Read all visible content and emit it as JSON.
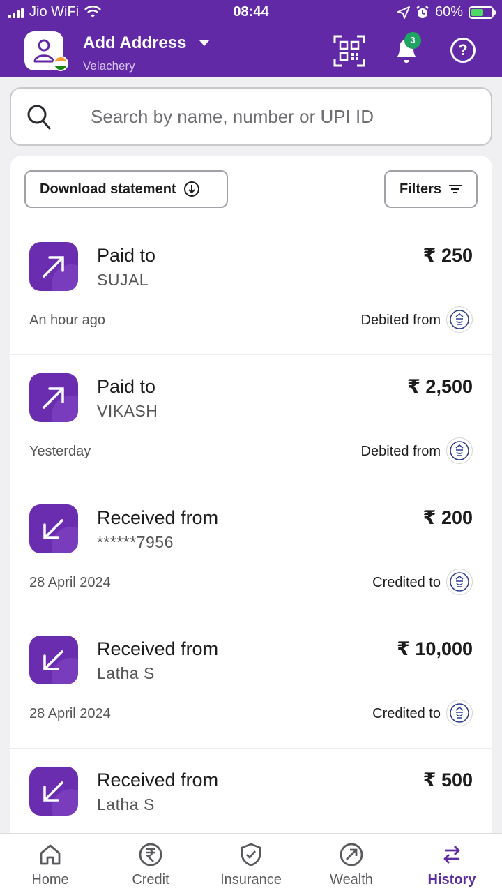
{
  "status_bar": {
    "carrier": "Jio WiFi",
    "time": "08:44",
    "battery": "60%"
  },
  "header": {
    "title": "Add Address",
    "location": "Velachery",
    "notification_count": "3",
    "help_label": "?"
  },
  "search": {
    "placeholder": "Search by name, number or UPI ID"
  },
  "actions": {
    "download_label": "Download statement",
    "filters_label": "Filters"
  },
  "transactions": [
    {
      "type": "Paid to",
      "party": "SUJAL",
      "amount": "₹ 250",
      "date": "An hour ago",
      "account": "Debited from",
      "direction": "outgoing"
    },
    {
      "type": "Paid to",
      "party": "VIKASH",
      "amount": "₹ 2,500",
      "date": "Yesterday",
      "account": "Debited from",
      "direction": "outgoing"
    },
    {
      "type": "Received from",
      "party": "******7956",
      "amount": "₹ 200",
      "date": "28 April 2024",
      "account": "Credited to",
      "direction": "incoming"
    },
    {
      "type": "Received from",
      "party": "Latha S",
      "amount": "₹ 10,000",
      "date": "28 April 2024",
      "account": "Credited to",
      "direction": "incoming"
    },
    {
      "type": "Received from",
      "party": "Latha S",
      "amount": "₹ 500",
      "date": "",
      "account": "",
      "direction": "incoming"
    }
  ],
  "bottom_nav": [
    {
      "label": "Home",
      "icon": "home-icon"
    },
    {
      "label": "Credit",
      "icon": "rupee-icon"
    },
    {
      "label": "Insurance",
      "icon": "shield-check-icon"
    },
    {
      "label": "Wealth",
      "icon": "compass-arrow-icon"
    },
    {
      "label": "History",
      "icon": "swap-arrows-icon",
      "active": true
    }
  ],
  "colors": {
    "brand": "#6229a6",
    "accent_icon": "#6b2db0",
    "active_nav": "#5c2da0",
    "badge": "#1fa463"
  }
}
